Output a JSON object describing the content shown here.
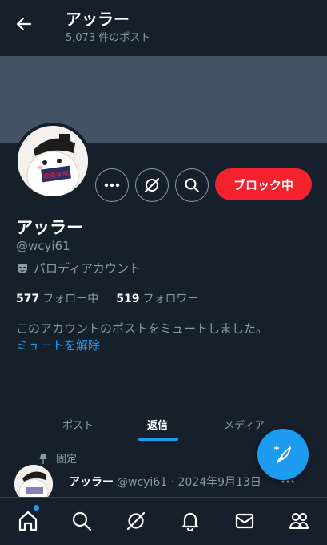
{
  "header": {
    "title": "アッラー",
    "post_count": "5,073 件のポスト"
  },
  "profile": {
    "display_name": "アッラー",
    "handle": "@wcyi61",
    "parody_label": "パロディアカウント",
    "following_count": "577",
    "following_label": "フォロー中",
    "followers_count": "519",
    "followers_label": "フォロワー",
    "muted_message": "このアカウントのポストをミュートしました。",
    "unmute_label": "ミュートを解除",
    "avatar_text": "吹奏楽部"
  },
  "actions": {
    "block_label": "ブロック中",
    "more_icon": "more-icon",
    "grok_icon": "grok-icon",
    "search_icon": "search-icon"
  },
  "tabs": [
    {
      "label": "ポスト",
      "active": false
    },
    {
      "label": "返信",
      "active": true
    },
    {
      "label": "メディア",
      "active": false
    }
  ],
  "pinned_post": {
    "pinned_label": "固定",
    "author": "アッラー",
    "meta": "@wcyi61 · 2024年9月13日"
  },
  "bottom_nav": [
    "home-icon",
    "search-icon",
    "grok-icon",
    "notifications-icon",
    "messages-icon",
    "communities-icon"
  ],
  "colors": {
    "background": "#15202b",
    "accent": "#1d9bf0",
    "block_red": "#f4212e",
    "secondary_text": "#8b98a5"
  }
}
